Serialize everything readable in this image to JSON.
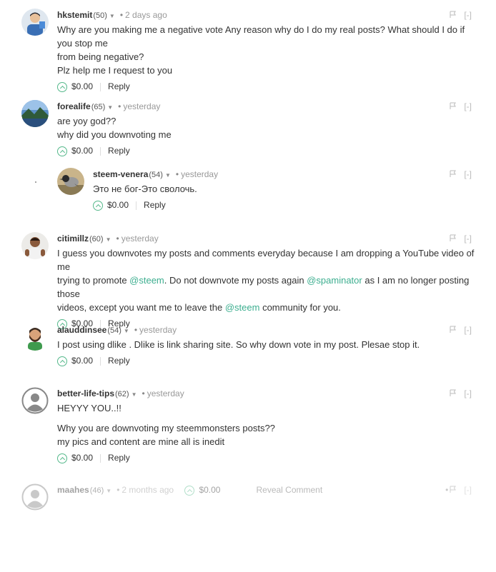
{
  "comments": [
    {
      "author": "hkstemit",
      "rep": "(50)",
      "time": "2 days ago",
      "lines": [
        "Why are you making me a negative vote Any reason why do I do my real posts? What should I do if you stop me",
        "from being negative?",
        "Plz help me I request to you"
      ],
      "payout": "$0.00",
      "reply": "Reply"
    },
    {
      "author": "forealife",
      "rep": "(65)",
      "time": "yesterday",
      "lines": [
        "are yoy god??",
        "why did you downvoting me"
      ],
      "payout": "$0.00",
      "reply": "Reply"
    },
    {
      "author": "steem-venera",
      "rep": "(54)",
      "time": "yesterday",
      "lines": [
        "Это не бог-Это сволочь."
      ],
      "payout": "$0.00",
      "reply": "Reply"
    },
    {
      "author": "citimillz",
      "rep": "(60)",
      "time": "yesterday",
      "line1": "I guess you downvotes my posts and comments everyday because I am dropping a YouTube video of me",
      "line2_a": "trying to promote ",
      "line2_m1": "@steem",
      "line2_b": ". Do not downvote my posts again ",
      "line2_m2": "@spaminator",
      "line2_c": " as I am no longer posting those",
      "line3_a": "videos, except you want me to leave the ",
      "line3_m": "@steem",
      "line3_b": " community for you.",
      "payout": "$0.00",
      "reply": "Reply"
    },
    {
      "author": "alauddinsee",
      "rep": "(54)",
      "time": "yesterday",
      "lines": [
        "I post using dlike . Dlike is link sharing site. So why down vote in my post. Plesae stop it."
      ],
      "payout": "$0.00",
      "reply": "Reply"
    },
    {
      "author": "better-life-tips",
      "rep": "(62)",
      "time": "yesterday",
      "lines": [
        "HEYYY YOU..!!",
        "Why you are downvoting my steemmonsters posts??",
        "my pics and content are mine all is inedit"
      ],
      "payout": "$0.00",
      "reply": "Reply"
    },
    {
      "author": "maahes",
      "rep": "(46)",
      "time": "2 months ago",
      "payout": "$0.00",
      "reveal": "Reveal Comment"
    }
  ],
  "ui": {
    "collapse": "[-]",
    "dot": "•",
    "caret": "▼"
  },
  "colors": {
    "accent": "#54b88a",
    "mention": "#3cae8f"
  },
  "icons": [
    "flag-icon",
    "upvote-icon",
    "collapse-icon",
    "chevron-down-icon"
  ]
}
